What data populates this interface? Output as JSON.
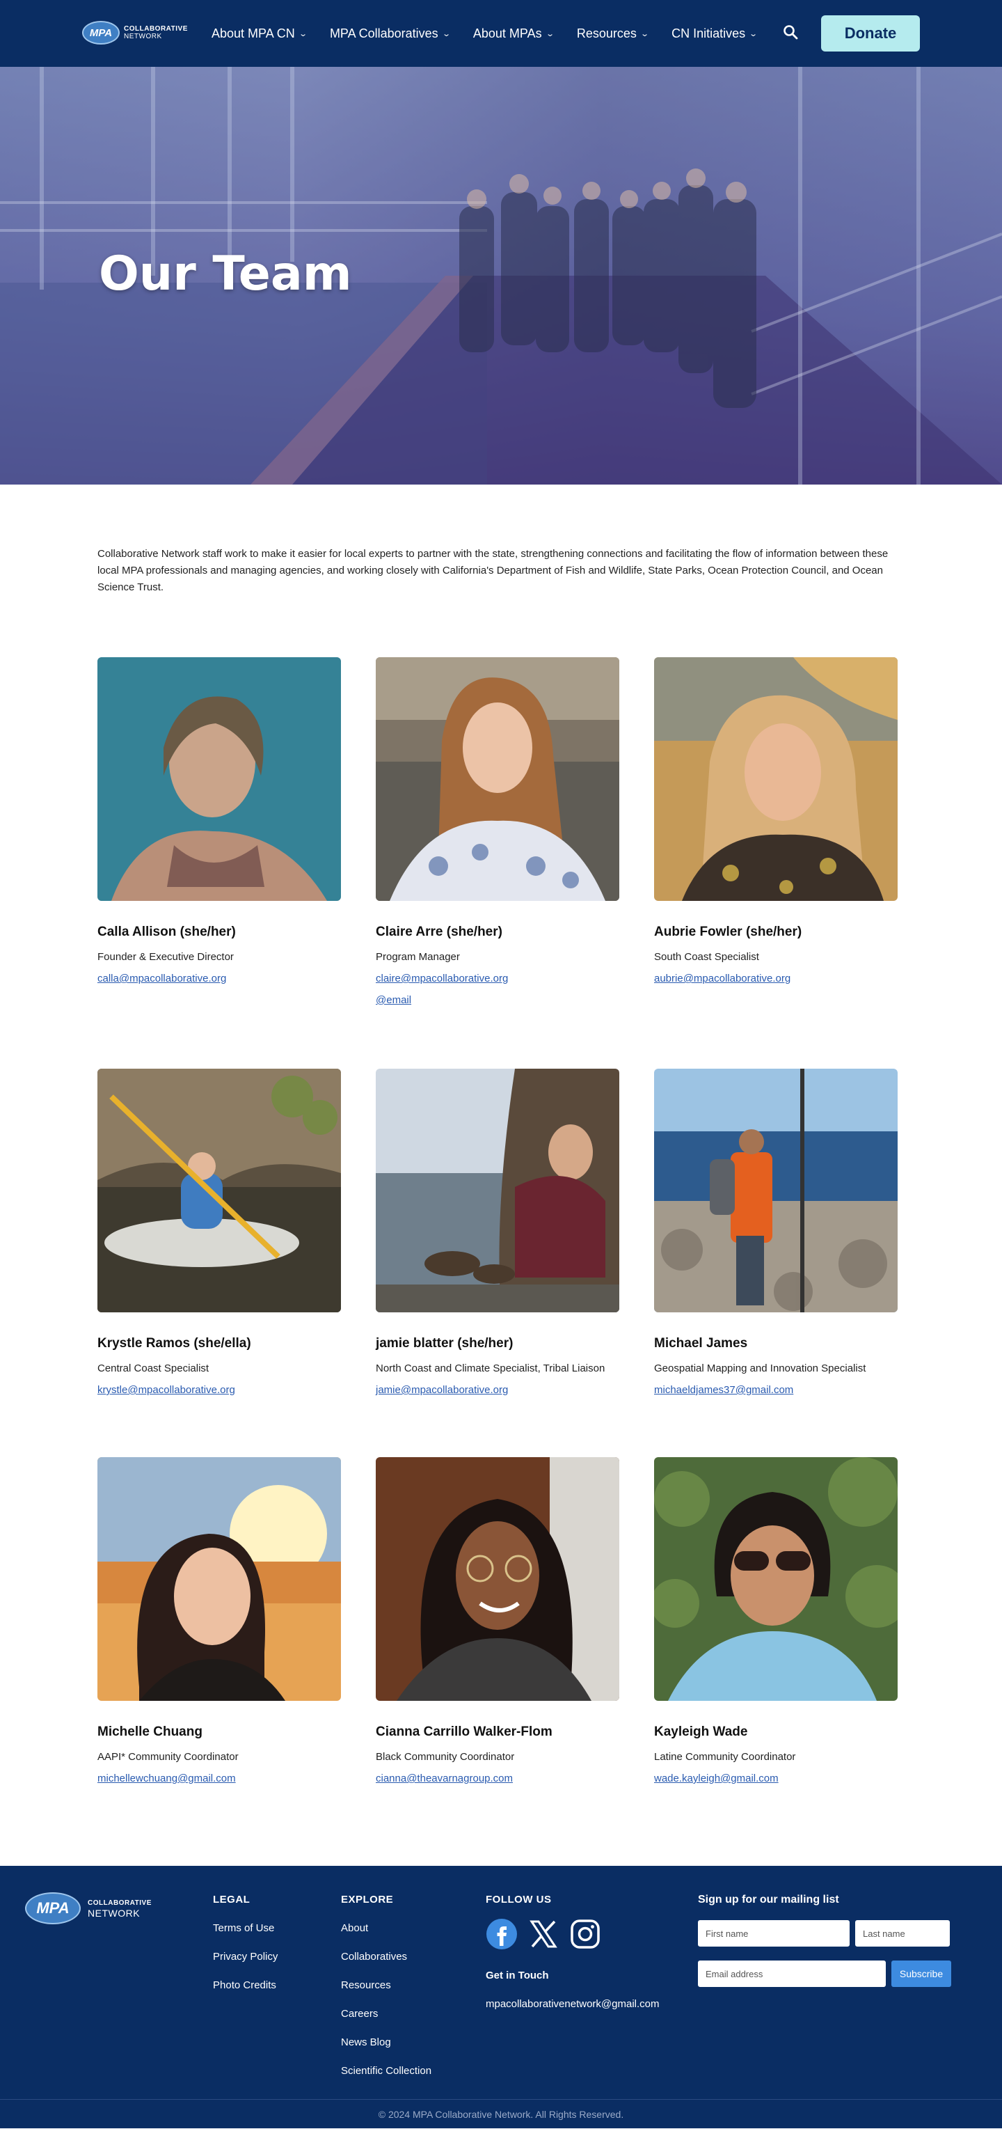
{
  "nav": {
    "logo_badge": "MPA",
    "logo_line1": "COLLABORATIVE",
    "logo_line2": "NETWORK",
    "items": [
      {
        "label": "About MPA CN"
      },
      {
        "label": "MPA Collaboratives"
      },
      {
        "label": "About MPAs"
      },
      {
        "label": "Resources"
      },
      {
        "label": "CN Initiatives"
      }
    ],
    "search_icon": "search-icon",
    "donate_label": "Donate"
  },
  "hero": {
    "title": "Our Team"
  },
  "intro": "Collaborative Network staff work to make it easier for local experts to partner with the state, strengthening connections and facilitating the flow of information between these local MPA professionals and managing agencies, and working closely with California's Department of Fish and Wildlife, State Parks, Ocean Protection Council, and Ocean Science Trust.",
  "team": [
    {
      "name": "Calla Allison (she/her)",
      "role": "Founder & Executive Director",
      "emails": [
        "calla@mpacollaborative.org"
      ]
    },
    {
      "name": "Claire Arre (she/her)",
      "role": "Program Manager",
      "emails": [
        "claire@mpacollaborative.org",
        "@email"
      ]
    },
    {
      "name": "Aubrie Fowler (she/her)",
      "role": "South Coast Specialist",
      "emails": [
        "aubrie@mpacollaborative.org"
      ]
    },
    {
      "name": "Krystle Ramos (she/ella)",
      "role": "Central Coast Specialist",
      "emails": [
        "krystle@mpacollaborative.org"
      ]
    },
    {
      "name": "jamie blatter (she/her)",
      "role": "North Coast and Climate Specialist, Tribal Liaison",
      "emails": [
        "jamie@mpacollaborative.org"
      ]
    },
    {
      "name": "Michael James",
      "role": "Geospatial Mapping and Innovation Specialist",
      "emails": [
        "michaeldjames37@gmail.com"
      ]
    },
    {
      "name": "Michelle Chuang",
      "role": "AAPI* Community Coordinator",
      "emails": [
        "michellewchuang@gmail.com"
      ]
    },
    {
      "name": "Cianna Carrillo Walker-Flom",
      "role": "Black Community Coordinator",
      "emails": [
        "cianna@theavarnagroup.com"
      ]
    },
    {
      "name": "Kayleigh Wade",
      "role": "Latine Community Coordinator",
      "emails": [
        "wade.kayleigh@gmail.com"
      ]
    }
  ],
  "footer": {
    "logo_badge": "MPA",
    "logo_line1": "COLLABORATIVE",
    "logo_line2": "NETWORK",
    "legal": {
      "heading": "LEGAL",
      "links": [
        "Terms of Use",
        "Privacy Policy",
        "Photo Credits"
      ]
    },
    "explore": {
      "heading": "EXPLORE",
      "links": [
        "About",
        "Collaboratives",
        "Resources",
        "Careers",
        "News Blog",
        "Scientific Collection"
      ]
    },
    "follow": {
      "heading": "FOLLOW US",
      "icons": [
        "facebook-icon",
        "x-icon",
        "instagram-icon"
      ],
      "get_in_touch": "Get in Touch",
      "email": "mpacollaborativenetwork@gmail.com"
    },
    "mailing": {
      "heading": "Sign up for our mailing list",
      "first_placeholder": "First name",
      "last_placeholder": "Last name",
      "email_placeholder": "Email address",
      "subscribe_label": "Subscribe"
    },
    "copyright": "© 2024 MPA Collaborative Network. All Rights Reserved."
  }
}
